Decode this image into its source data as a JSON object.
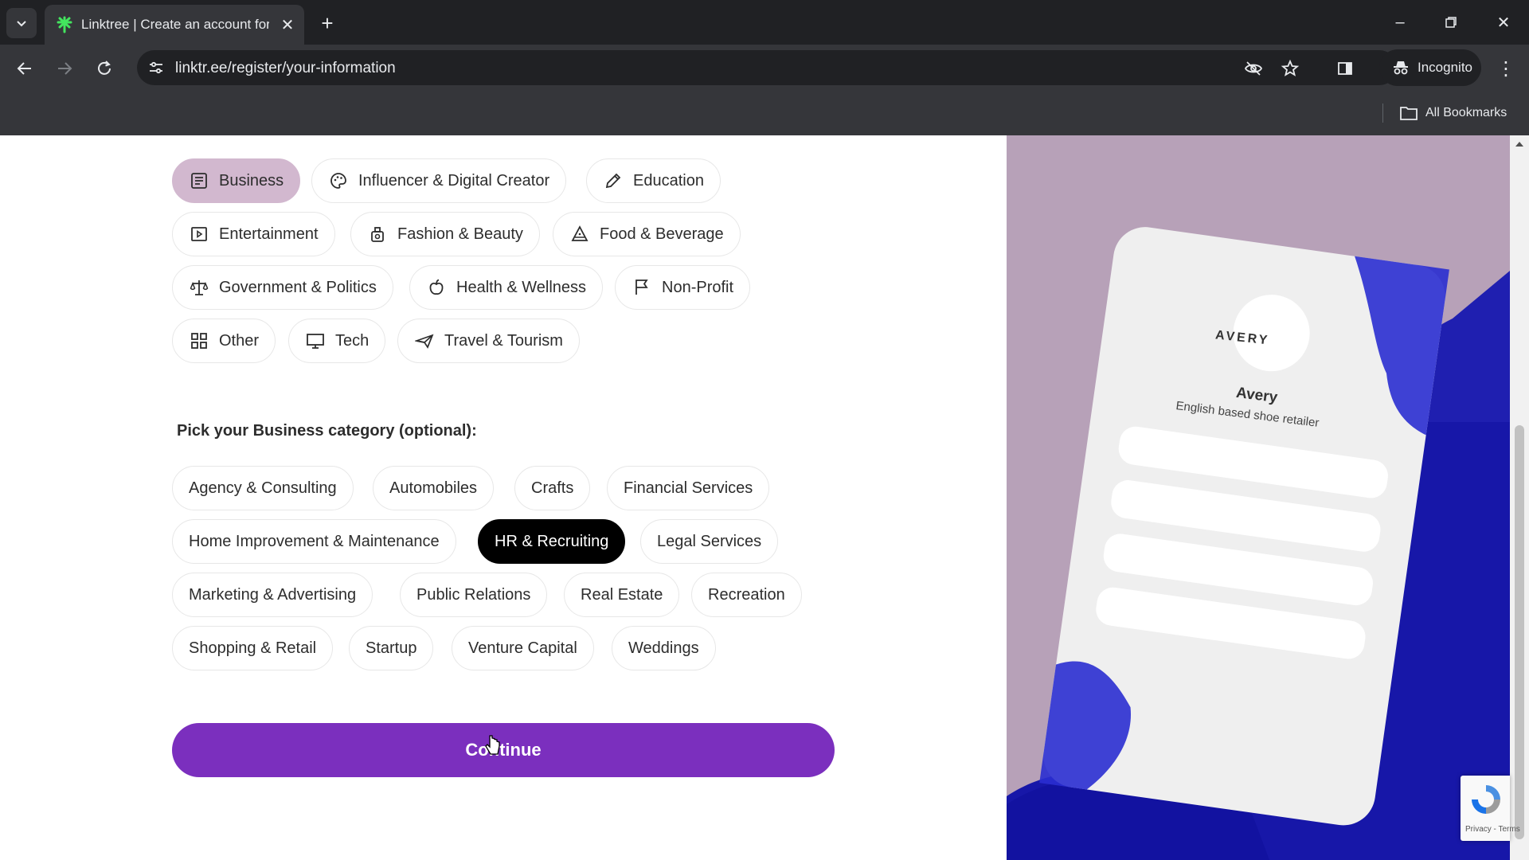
{
  "browser": {
    "tab_title": "Linktree | Create an account for",
    "url": "linktr.ee/register/your-information",
    "incognito_label": "Incognito",
    "bookmarks_label": "All Bookmarks"
  },
  "categories": [
    {
      "label": "Business",
      "icon": "document-icon",
      "selected": true
    },
    {
      "label": "Influencer & Digital Creator",
      "icon": "palette-icon",
      "selected": false
    },
    {
      "label": "Education",
      "icon": "pencil-icon",
      "selected": false
    },
    {
      "label": "Entertainment",
      "icon": "play-icon",
      "selected": false
    },
    {
      "label": "Fashion & Beauty",
      "icon": "perfume-icon",
      "selected": false
    },
    {
      "label": "Food & Beverage",
      "icon": "pizza-icon",
      "selected": false
    },
    {
      "label": "Government & Politics",
      "icon": "scale-icon",
      "selected": false
    },
    {
      "label": "Health & Wellness",
      "icon": "apple-icon",
      "selected": false
    },
    {
      "label": "Non-Profit",
      "icon": "flag-icon",
      "selected": false
    },
    {
      "label": "Other",
      "icon": "grid-icon",
      "selected": false
    },
    {
      "label": "Tech",
      "icon": "monitor-icon",
      "selected": false
    },
    {
      "label": "Travel & Tourism",
      "icon": "plane-icon",
      "selected": false
    }
  ],
  "subcategory_heading": "Pick your Business category (optional):",
  "subcategories": [
    {
      "label": "Agency & Consulting",
      "selected": false
    },
    {
      "label": "Automobiles",
      "selected": false
    },
    {
      "label": "Crafts",
      "selected": false
    },
    {
      "label": "Financial Services",
      "selected": false
    },
    {
      "label": "Home Improvement & Maintenance",
      "selected": false
    },
    {
      "label": "HR & Recruiting",
      "selected": true
    },
    {
      "label": "Legal Services",
      "selected": false
    },
    {
      "label": "Marketing & Advertising",
      "selected": false
    },
    {
      "label": "Public Relations",
      "selected": false
    },
    {
      "label": "Real Estate",
      "selected": false
    },
    {
      "label": "Recreation",
      "selected": false
    },
    {
      "label": "Shopping & Retail",
      "selected": false
    },
    {
      "label": "Startup",
      "selected": false
    },
    {
      "label": "Venture Capital",
      "selected": false
    },
    {
      "label": "Weddings",
      "selected": false
    }
  ],
  "continue_label": "Continue",
  "preview": {
    "logo_text": "AVERY",
    "name": "Avery",
    "bio": "English based shoe retailer"
  },
  "recaptcha": {
    "text": "Privacy - Terms"
  },
  "colors": {
    "accent": "#7b2fbe",
    "selected_category": "#d2b8cf",
    "side_panel": "#b7a1b8",
    "brush_blue": "#1f1fb0"
  }
}
